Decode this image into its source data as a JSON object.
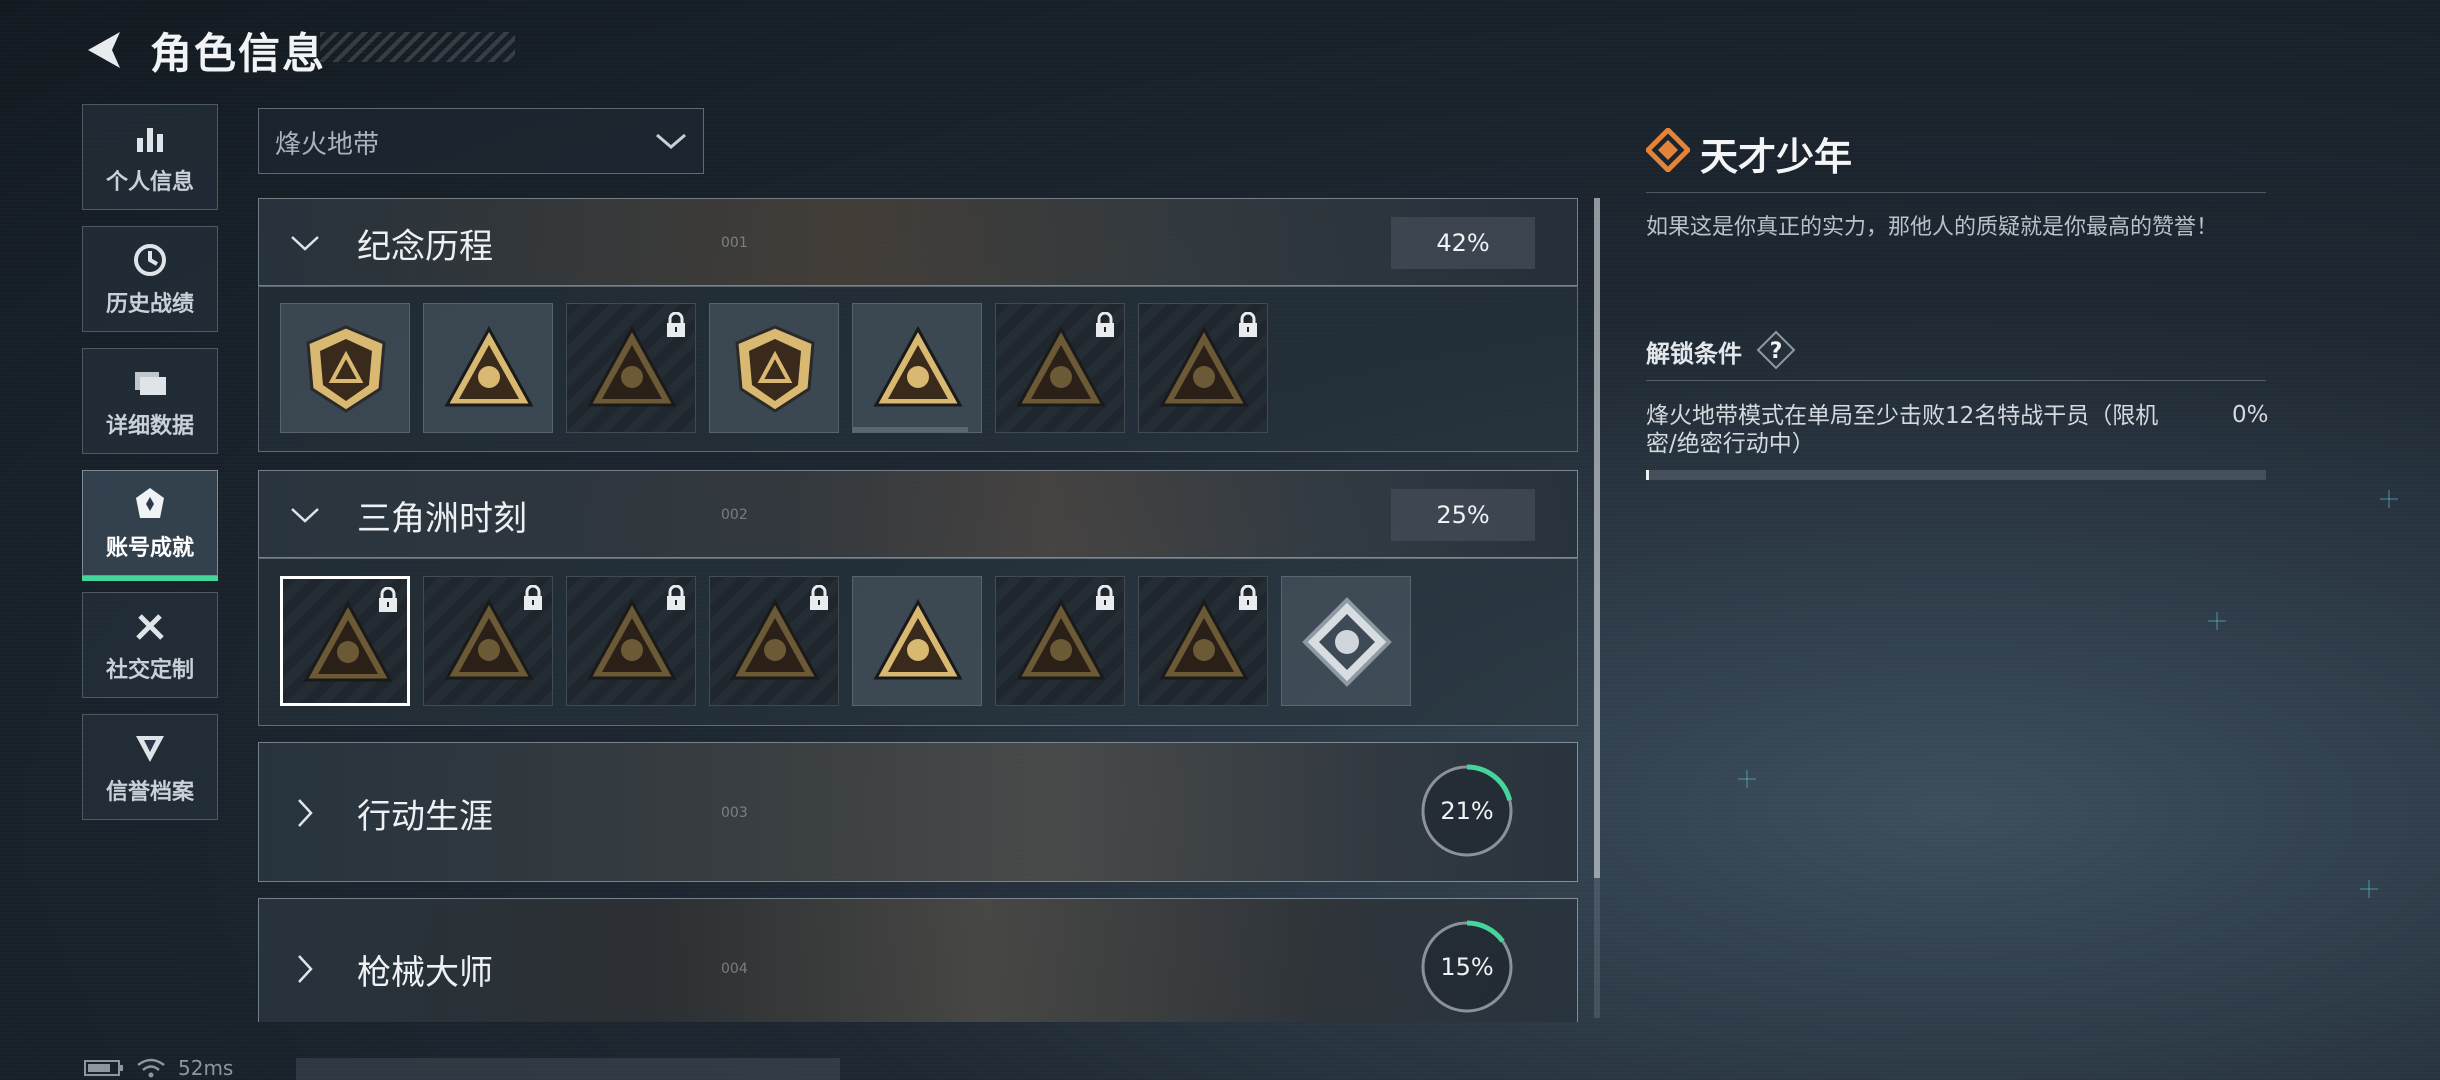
{
  "header": {
    "title": "角色信息"
  },
  "nav": [
    {
      "label": "个人信息",
      "icon": "bar-chart-icon"
    },
    {
      "label": "历史战绩",
      "icon": "history-clock-icon"
    },
    {
      "label": "详细数据",
      "icon": "folder-icon"
    },
    {
      "label": "账号成就",
      "icon": "achievement-badge-icon",
      "active": true
    },
    {
      "label": "社交定制",
      "icon": "tools-icon"
    },
    {
      "label": "信誉档案",
      "icon": "credit-shield-icon"
    }
  ],
  "mode_select": {
    "value": "烽火地带"
  },
  "categories": [
    {
      "name": "纪念历程",
      "number": "001",
      "percent": "42%",
      "expanded": true,
      "badges": [
        {
          "locked": false,
          "icon": "mountain-emblem-icon"
        },
        {
          "locked": false,
          "icon": "helicopter-emblem-icon"
        },
        {
          "locked": true,
          "icon": "dark-shield-emblem-icon"
        },
        {
          "locked": false,
          "icon": "s8-emblem-icon"
        },
        {
          "locked": false,
          "icon": "supply-emblem-icon",
          "progress": 0.9
        },
        {
          "locked": true,
          "icon": "operator-emblem-icon"
        },
        {
          "locked": true,
          "icon": "soldier-emblem-icon"
        }
      ]
    },
    {
      "name": "三角洲时刻",
      "number": "002",
      "percent": "25%",
      "expanded": true,
      "badges": [
        {
          "locked": true,
          "icon": "crate-emblem-icon",
          "selected": true
        },
        {
          "locked": true,
          "icon": "shield-tri-emblem-icon"
        },
        {
          "locked": true,
          "icon": "runner-emblem-icon"
        },
        {
          "locked": true,
          "icon": "hands-emblem-icon"
        },
        {
          "locked": false,
          "icon": "squad-emblem-icon"
        },
        {
          "locked": true,
          "icon": "team-emblem-icon"
        },
        {
          "locked": true,
          "icon": "dragon-emblem-icon"
        },
        {
          "locked": false,
          "icon": "rose-diamond-emblem-icon"
        }
      ]
    },
    {
      "name": "行动生涯",
      "number": "003",
      "percent": "21%",
      "progress": 0.21,
      "expanded": false
    },
    {
      "name": "枪械大师",
      "number": "004",
      "percent": "15%",
      "progress": 0.15,
      "expanded": false
    }
  ],
  "detail": {
    "title": "天才少年",
    "description": "如果这是你真正的实力，那他人的质疑就是你最高的赞誉！",
    "condition_label": "解锁条件",
    "condition_text": "烽火地带模式在单局至少击败12名特战干员（限机密/绝密行动中）",
    "condition_percent": "0%",
    "condition_progress": 0.0
  },
  "status": {
    "ping": "52ms"
  },
  "colors": {
    "accent_green": "#43d59a",
    "accent_orange": "#e4843a",
    "gold": "#c9a863"
  }
}
